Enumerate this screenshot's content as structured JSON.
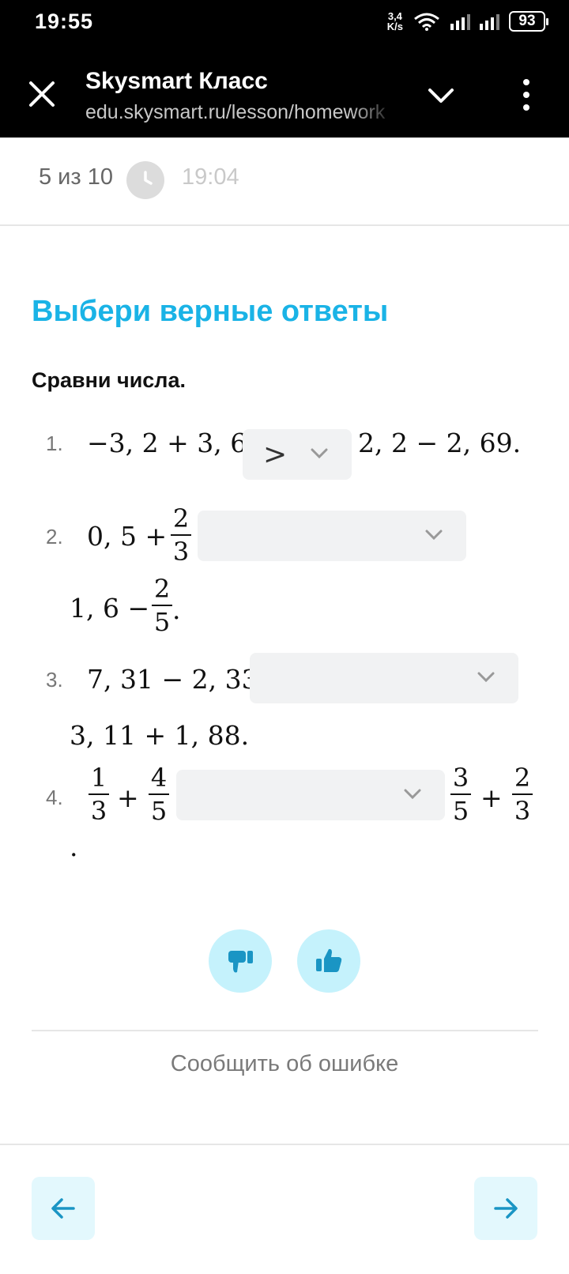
{
  "status_bar": {
    "time": "19:55",
    "net_speed_value": "3,4",
    "net_speed_unit": "K/s",
    "battery": "93"
  },
  "browser": {
    "title": "Skysmart Класс",
    "url": "edu.skysmart.ru/lesson/homework"
  },
  "progress": {
    "count": "5 из 10",
    "time": "19:04"
  },
  "task": {
    "title": "Выбери верные ответы",
    "subtitle": "Сравни числа."
  },
  "items": [
    {
      "number": "1.",
      "left": "−3, 2 + 3, 6",
      "selected": ">",
      "right": "2, 2 − 2, 69."
    },
    {
      "number": "2.",
      "left_whole": "0, 5 +",
      "left_frac_num": "2",
      "left_frac_den": "3",
      "selected": "",
      "right_whole": "1, 6 −",
      "right_frac_num": "2",
      "right_frac_den": "5",
      "right_end": "."
    },
    {
      "number": "3.",
      "left": "7, 31 − 2, 33",
      "selected": "",
      "right": "3, 11 + 1, 88."
    },
    {
      "number": "4.",
      "a_num": "1",
      "a_den": "3",
      "op1": "+",
      "b_num": "4",
      "b_den": "5",
      "selected": "",
      "c_num": "3",
      "c_den": "5",
      "op2": "+",
      "d_num": "2",
      "d_den": "3",
      "end": "."
    }
  ],
  "footer": {
    "report_label": "Сообщить об ошибке"
  },
  "colors": {
    "accent": "#1ab3e6",
    "feedback_bg": "#c5f2fc",
    "nav_bg": "#e3f8fd",
    "icon": "#1a95c4"
  }
}
